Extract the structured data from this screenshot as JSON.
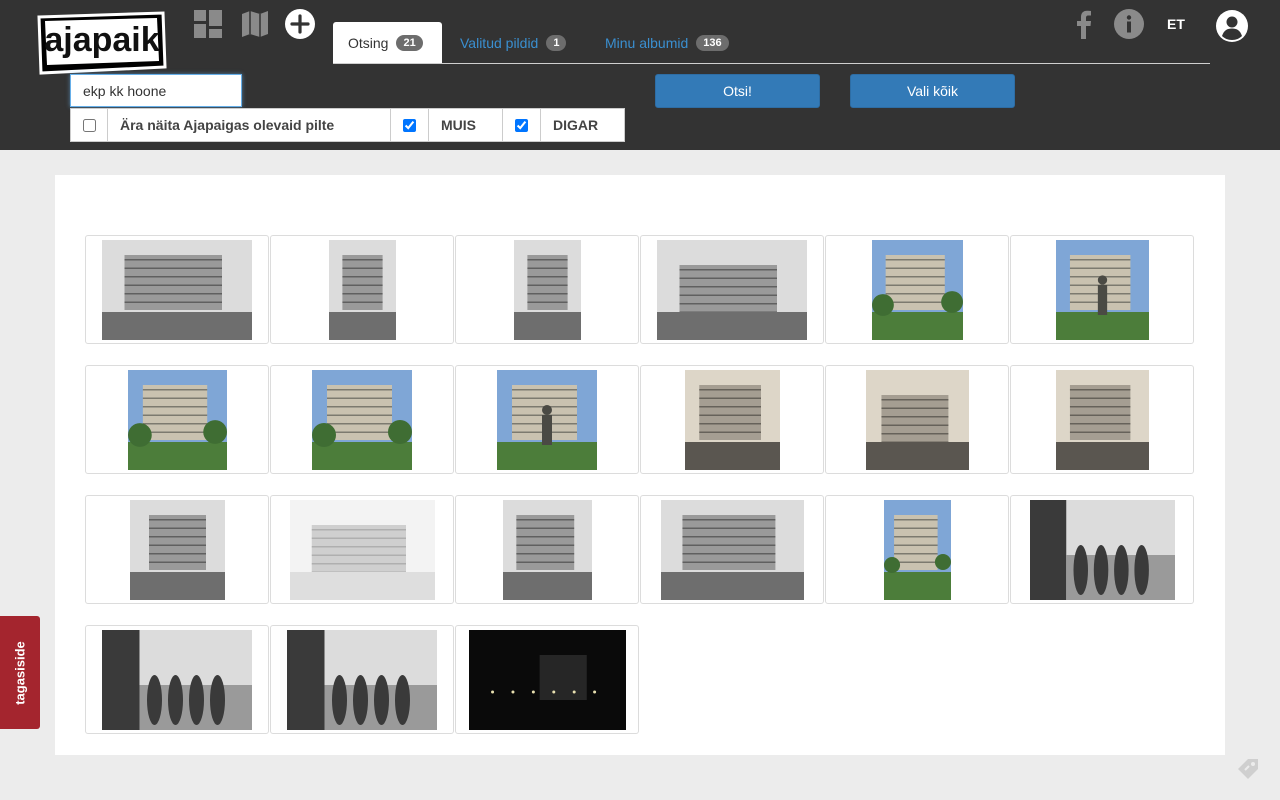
{
  "header": {
    "logo_text": "ajapaik",
    "icons": [
      "grid-view-icon",
      "map-icon",
      "add-icon",
      "facebook-icon",
      "info-icon",
      "user-icon"
    ],
    "language": "ET",
    "tabs": [
      {
        "label": "Otsing",
        "count": "21",
        "active": true
      },
      {
        "label": "Valitud pildid",
        "count": "1",
        "active": false
      },
      {
        "label": "Minu albumid",
        "count": "136",
        "active": false
      }
    ]
  },
  "search": {
    "value": "ekp kk hoone",
    "button_label": "Otsi!",
    "select_all_label": "Vali kõik"
  },
  "filters": [
    {
      "label": "Ära näita Ajapaigas olevaid pilte",
      "checked": false
    },
    {
      "label": "MUIS",
      "checked": true
    },
    {
      "label": "DIGAR",
      "checked": true
    }
  ],
  "results": {
    "count": 21
  },
  "feedback": {
    "label": "tagasiside"
  },
  "colors": {
    "header_bg": "#333333",
    "accent": "#337ab7",
    "link": "#3a8fd0",
    "feedback": "#a4252e"
  }
}
